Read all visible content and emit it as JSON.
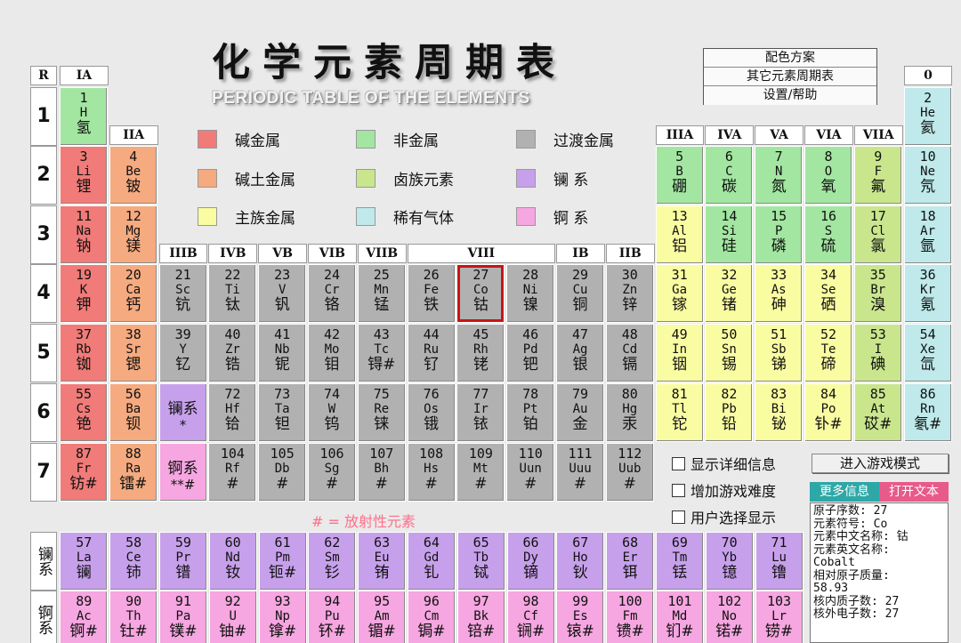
{
  "header": {
    "title": "化学元素周期表",
    "subtitle": "PERIODIC TABLE OF THE ELEMENTS"
  },
  "menu": {
    "color_scheme": "配色方案",
    "other_tables": "其它元素周期表",
    "settings_help": "设置/帮助"
  },
  "colors": {
    "alkali": "#f07b78",
    "alkaline_earth": "#f5aa7f",
    "nonmetal": "#a3e6a1",
    "halogen": "#c9e68d",
    "noble_gas": "#bfe9ea",
    "main_metal": "#fafca1",
    "transition": "#b1b1b1",
    "lanthanide": "#c7a0ec",
    "actinide": "#f6a6e0",
    "tab_info": "#2ea7a7",
    "tab_text": "#e85a8a",
    "radio_text": "#ff6f8a",
    "selected_outline": "#c81414"
  },
  "legend": [
    {
      "label": "碱金属",
      "cat": "alkali"
    },
    {
      "label": "碱土金属",
      "cat": "alkaline_earth"
    },
    {
      "label": "主族金属",
      "cat": "main_metal"
    },
    {
      "label": "非金属",
      "cat": "nonmetal"
    },
    {
      "label": "卤族元素",
      "cat": "halogen"
    },
    {
      "label": "稀有气体",
      "cat": "noble_gas"
    },
    {
      "label": "过渡金属",
      "cat": "transition"
    },
    {
      "label": "镧 系",
      "cat": "lanthanide"
    },
    {
      "label": "锕 系",
      "cat": "actinide"
    }
  ],
  "corner_label": "R",
  "group_headers": [
    "IA",
    "IIA",
    "IIIB",
    "IVB",
    "VB",
    "VIB",
    "VIIB",
    "VIII",
    "IB",
    "IIB",
    "IIIA",
    "IVA",
    "VA",
    "VIA",
    "VIIA",
    "0"
  ],
  "period_labels": [
    "1",
    "2",
    "3",
    "4",
    "5",
    "6",
    "7"
  ],
  "elements": [
    {
      "n": "1",
      "s": "H",
      "c": "氢",
      "cat": "nonmetal"
    },
    {
      "n": "2",
      "s": "He",
      "c": "氦",
      "cat": "noble_gas"
    },
    {
      "n": "3",
      "s": "Li",
      "c": "锂",
      "cat": "alkali"
    },
    {
      "n": "4",
      "s": "Be",
      "c": "铍",
      "cat": "alkaline_earth"
    },
    {
      "n": "5",
      "s": "B",
      "c": "硼",
      "cat": "nonmetal"
    },
    {
      "n": "6",
      "s": "C",
      "c": "碳",
      "cat": "nonmetal"
    },
    {
      "n": "7",
      "s": "N",
      "c": "氮",
      "cat": "nonmetal"
    },
    {
      "n": "8",
      "s": "O",
      "c": "氧",
      "cat": "nonmetal"
    },
    {
      "n": "9",
      "s": "F",
      "c": "氟",
      "cat": "halogen"
    },
    {
      "n": "10",
      "s": "Ne",
      "c": "氖",
      "cat": "noble_gas"
    },
    {
      "n": "11",
      "s": "Na",
      "c": "钠",
      "cat": "alkali"
    },
    {
      "n": "12",
      "s": "Mg",
      "c": "镁",
      "cat": "alkaline_earth"
    },
    {
      "n": "13",
      "s": "Al",
      "c": "铝",
      "cat": "main_metal"
    },
    {
      "n": "14",
      "s": "Si",
      "c": "硅",
      "cat": "nonmetal"
    },
    {
      "n": "15",
      "s": "P",
      "c": "磷",
      "cat": "nonmetal"
    },
    {
      "n": "16",
      "s": "S",
      "c": "硫",
      "cat": "nonmetal"
    },
    {
      "n": "17",
      "s": "Cl",
      "c": "氯",
      "cat": "halogen"
    },
    {
      "n": "18",
      "s": "Ar",
      "c": "氩",
      "cat": "noble_gas"
    },
    {
      "n": "19",
      "s": "K",
      "c": "钾",
      "cat": "alkali"
    },
    {
      "n": "20",
      "s": "Ca",
      "c": "钙",
      "cat": "alkaline_earth"
    },
    {
      "n": "21",
      "s": "Sc",
      "c": "钪",
      "cat": "transition"
    },
    {
      "n": "22",
      "s": "Ti",
      "c": "钛",
      "cat": "transition"
    },
    {
      "n": "23",
      "s": "V",
      "c": "钒",
      "cat": "transition"
    },
    {
      "n": "24",
      "s": "Cr",
      "c": "铬",
      "cat": "transition"
    },
    {
      "n": "25",
      "s": "Mn",
      "c": "锰",
      "cat": "transition"
    },
    {
      "n": "26",
      "s": "Fe",
      "c": "铁",
      "cat": "transition"
    },
    {
      "n": "27",
      "s": "Co",
      "c": "钴",
      "cat": "transition",
      "selected": true
    },
    {
      "n": "28",
      "s": "Ni",
      "c": "镍",
      "cat": "transition"
    },
    {
      "n": "29",
      "s": "Cu",
      "c": "铜",
      "cat": "transition"
    },
    {
      "n": "30",
      "s": "Zn",
      "c": "锌",
      "cat": "transition"
    },
    {
      "n": "31",
      "s": "Ga",
      "c": "镓",
      "cat": "main_metal"
    },
    {
      "n": "32",
      "s": "Ge",
      "c": "锗",
      "cat": "main_metal"
    },
    {
      "n": "33",
      "s": "As",
      "c": "砷",
      "cat": "main_metal"
    },
    {
      "n": "34",
      "s": "Se",
      "c": "硒",
      "cat": "main_metal"
    },
    {
      "n": "35",
      "s": "Br",
      "c": "溴",
      "cat": "halogen"
    },
    {
      "n": "36",
      "s": "Kr",
      "c": "氪",
      "cat": "noble_gas"
    },
    {
      "n": "37",
      "s": "Rb",
      "c": "铷",
      "cat": "alkali"
    },
    {
      "n": "38",
      "s": "Sr",
      "c": "锶",
      "cat": "alkaline_earth"
    },
    {
      "n": "39",
      "s": "Y",
      "c": "钇",
      "cat": "transition"
    },
    {
      "n": "40",
      "s": "Zr",
      "c": "锆",
      "cat": "transition"
    },
    {
      "n": "41",
      "s": "Nb",
      "c": "铌",
      "cat": "transition"
    },
    {
      "n": "42",
      "s": "Mo",
      "c": "钼",
      "cat": "transition"
    },
    {
      "n": "43",
      "s": "Tc",
      "c": "锝#",
      "cat": "transition"
    },
    {
      "n": "44",
      "s": "Ru",
      "c": "钌",
      "cat": "transition"
    },
    {
      "n": "45",
      "s": "Rh",
      "c": "铑",
      "cat": "transition"
    },
    {
      "n": "46",
      "s": "Pd",
      "c": "钯",
      "cat": "transition"
    },
    {
      "n": "47",
      "s": "Ag",
      "c": "银",
      "cat": "transition"
    },
    {
      "n": "48",
      "s": "Cd",
      "c": "镉",
      "cat": "transition"
    },
    {
      "n": "49",
      "s": "In",
      "c": "铟",
      "cat": "main_metal"
    },
    {
      "n": "50",
      "s": "Sn",
      "c": "锡",
      "cat": "main_metal"
    },
    {
      "n": "51",
      "s": "Sb",
      "c": "锑",
      "cat": "main_metal"
    },
    {
      "n": "52",
      "s": "Te",
      "c": "碲",
      "cat": "main_metal"
    },
    {
      "n": "53",
      "s": "I",
      "c": "碘",
      "cat": "halogen"
    },
    {
      "n": "54",
      "s": "Xe",
      "c": "氙",
      "cat": "noble_gas"
    },
    {
      "n": "55",
      "s": "Cs",
      "c": "铯",
      "cat": "alkali"
    },
    {
      "n": "56",
      "s": "Ba",
      "c": "钡",
      "cat": "alkaline_earth"
    },
    {
      "n": "",
      "s": "镧系",
      "c": "*",
      "cat": "lanthanide"
    },
    {
      "n": "72",
      "s": "Hf",
      "c": "铪",
      "cat": "transition"
    },
    {
      "n": "73",
      "s": "Ta",
      "c": "钽",
      "cat": "transition"
    },
    {
      "n": "74",
      "s": "W",
      "c": "钨",
      "cat": "transition"
    },
    {
      "n": "75",
      "s": "Re",
      "c": "铼",
      "cat": "transition"
    },
    {
      "n": "76",
      "s": "Os",
      "c": "锇",
      "cat": "transition"
    },
    {
      "n": "77",
      "s": "Ir",
      "c": "铱",
      "cat": "transition"
    },
    {
      "n": "78",
      "s": "Pt",
      "c": "铂",
      "cat": "transition"
    },
    {
      "n": "79",
      "s": "Au",
      "c": "金",
      "cat": "transition"
    },
    {
      "n": "80",
      "s": "Hg",
      "c": "汞",
      "cat": "transition"
    },
    {
      "n": "81",
      "s": "Tl",
      "c": "铊",
      "cat": "main_metal"
    },
    {
      "n": "82",
      "s": "Pb",
      "c": "铅",
      "cat": "main_metal"
    },
    {
      "n": "83",
      "s": "Bi",
      "c": "铋",
      "cat": "main_metal"
    },
    {
      "n": "84",
      "s": "Po",
      "c": "钋#",
      "cat": "main_metal"
    },
    {
      "n": "85",
      "s": "At",
      "c": "砹#",
      "cat": "halogen"
    },
    {
      "n": "86",
      "s": "Rn",
      "c": "氡#",
      "cat": "noble_gas"
    },
    {
      "n": "87",
      "s": "Fr",
      "c": "钫#",
      "cat": "alkali"
    },
    {
      "n": "88",
      "s": "Ra",
      "c": "镭#",
      "cat": "alkaline_earth"
    },
    {
      "n": "",
      "s": "锕系",
      "c": "**#",
      "cat": "actinide"
    },
    {
      "n": "104",
      "s": "Rf",
      "c": "#",
      "cat": "transition"
    },
    {
      "n": "105",
      "s": "Db",
      "c": "#",
      "cat": "transition"
    },
    {
      "n": "106",
      "s": "Sg",
      "c": "#",
      "cat": "transition"
    },
    {
      "n": "107",
      "s": "Bh",
      "c": "#",
      "cat": "transition"
    },
    {
      "n": "108",
      "s": "Hs",
      "c": "#",
      "cat": "transition"
    },
    {
      "n": "109",
      "s": "Mt",
      "c": "#",
      "cat": "transition"
    },
    {
      "n": "110",
      "s": "Uun",
      "c": "#",
      "cat": "transition"
    },
    {
      "n": "111",
      "s": "Uuu",
      "c": "#",
      "cat": "transition"
    },
    {
      "n": "112",
      "s": "Uub",
      "c": "#",
      "cat": "transition"
    }
  ],
  "lanthanide_label": "镧系",
  "actinide_label": "锕系",
  "lanthanides": [
    {
      "n": "57",
      "s": "La",
      "c": "镧"
    },
    {
      "n": "58",
      "s": "Ce",
      "c": "铈"
    },
    {
      "n": "59",
      "s": "Pr",
      "c": "镨"
    },
    {
      "n": "60",
      "s": "Nd",
      "c": "钕"
    },
    {
      "n": "61",
      "s": "Pm",
      "c": "钷#"
    },
    {
      "n": "62",
      "s": "Sm",
      "c": "钐"
    },
    {
      "n": "63",
      "s": "Eu",
      "c": "铕"
    },
    {
      "n": "64",
      "s": "Gd",
      "c": "钆"
    },
    {
      "n": "65",
      "s": "Tb",
      "c": "铽"
    },
    {
      "n": "66",
      "s": "Dy",
      "c": "镝"
    },
    {
      "n": "67",
      "s": "Ho",
      "c": "钬"
    },
    {
      "n": "68",
      "s": "Er",
      "c": "铒"
    },
    {
      "n": "69",
      "s": "Tm",
      "c": "铥"
    },
    {
      "n": "70",
      "s": "Yb",
      "c": "镱"
    },
    {
      "n": "71",
      "s": "Lu",
      "c": "镥"
    }
  ],
  "actinides": [
    {
      "n": "89",
      "s": "Ac",
      "c": "锕#"
    },
    {
      "n": "90",
      "s": "Th",
      "c": "钍#"
    },
    {
      "n": "91",
      "s": "Pa",
      "c": "镤#"
    },
    {
      "n": "92",
      "s": "U",
      "c": "铀#"
    },
    {
      "n": "93",
      "s": "Np",
      "c": "镎#"
    },
    {
      "n": "94",
      "s": "Pu",
      "c": "钚#"
    },
    {
      "n": "95",
      "s": "Am",
      "c": "镅#"
    },
    {
      "n": "96",
      "s": "Cm",
      "c": "锔#"
    },
    {
      "n": "97",
      "s": "Bk",
      "c": "锫#"
    },
    {
      "n": "98",
      "s": "Cf",
      "c": "锎#"
    },
    {
      "n": "99",
      "s": "Es",
      "c": "锿#"
    },
    {
      "n": "100",
      "s": "Fm",
      "c": "镄#"
    },
    {
      "n": "101",
      "s": "Md",
      "c": "钔#"
    },
    {
      "n": "102",
      "s": "No",
      "c": "锘#"
    },
    {
      "n": "103",
      "s": "Lr",
      "c": "铹#"
    }
  ],
  "radioactive_note": "# = 放射性元素",
  "options": {
    "show_details": "显示详细信息",
    "increase_difficulty": "增加游戏难度",
    "user_select": "用户选择显示"
  },
  "game_mode_button": "进入游戏模式",
  "tabs": {
    "more_info": "更多信息",
    "open_text": "打开文本"
  },
  "info_panel": {
    "atomic_number": "原子序数: 27",
    "symbol": "元素符号: Co",
    "chinese_name": "元素中文名称: 钴",
    "english_name_label": "元素英文名称:",
    "english_name": "Cobalt",
    "mass_label": "相对原子质量:",
    "mass": "58.93",
    "protons": "核内质子数: 27",
    "electrons": "核外电子数: 27"
  }
}
